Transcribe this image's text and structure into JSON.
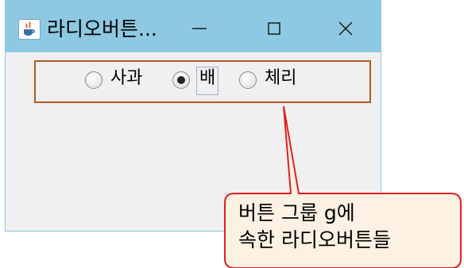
{
  "window": {
    "title": "라디오버튼...",
    "minimize_glyph": "—",
    "close_glyph": "×"
  },
  "radio_group": {
    "options": [
      {
        "label": "사과",
        "selected": false
      },
      {
        "label": "배",
        "selected": true
      },
      {
        "label": "체리",
        "selected": false
      }
    ]
  },
  "callout": {
    "line1": "버튼 그룹 g에",
    "line2": "속한 라디오버튼들",
    "fill_color": "#fdf1e3",
    "border_color": "#e02020"
  },
  "colors": {
    "titlebar": "#8dc9e2",
    "panel_border": "#b35b25",
    "window_bg": "#f0f0f0"
  },
  "icons": [
    "java-app-icon",
    "minimize-icon",
    "maximize-icon",
    "close-icon"
  ]
}
